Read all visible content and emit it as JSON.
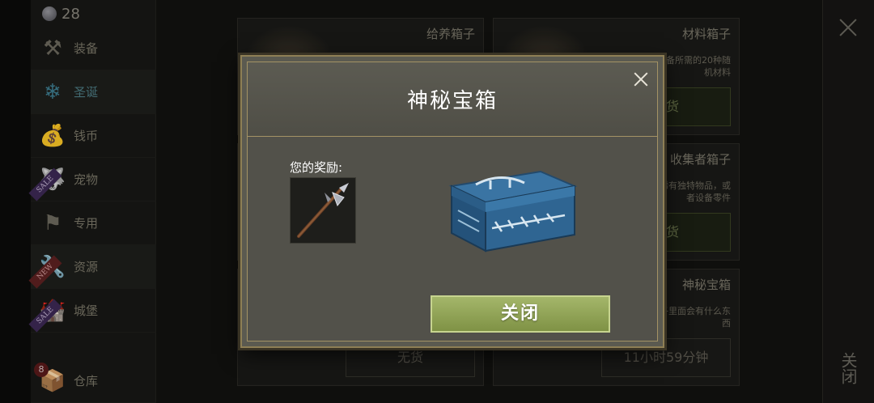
{
  "sidebar": {
    "currency_amount": "28",
    "items": [
      {
        "label": "装备",
        "icon": "crossed-tools-icon",
        "badge": ""
      },
      {
        "label": "圣诞",
        "icon": "snowflake-icon",
        "badge": ""
      },
      {
        "label": "钱币",
        "icon": "coin-bag-icon",
        "badge": ""
      },
      {
        "label": "宠物",
        "icon": "pet-icon",
        "badge": "SALE"
      },
      {
        "label": "专用",
        "icon": "banner-icon",
        "badge": ""
      },
      {
        "label": "资源",
        "icon": "tools-icon",
        "badge": "NEW"
      },
      {
        "label": "城堡",
        "icon": "castle-icon",
        "badge": "SALE"
      },
      {
        "label": "仓库",
        "icon": "storage-icon",
        "count": "8"
      }
    ]
  },
  "right_panel": {
    "close_label": "关闭"
  },
  "shop_cards": [
    {
      "title": "给养箱子",
      "desc": "",
      "button": "无货"
    },
    {
      "title": "材料箱子",
      "desc": "制作装备所需的20种随机材料",
      "button": "无货"
    },
    {
      "title": "收集者箱子",
      "desc": "包括稀有独特物品，或者设备零件",
      "button": "无货"
    },
    {
      "title": "",
      "desc": "",
      "button": "无货"
    },
    {
      "title": "",
      "desc": "",
      "button": "无货"
    },
    {
      "title": "神秘宝箱",
      "desc": "个箱子里面会有什么东西",
      "button": "11小时59分钟"
    }
  ],
  "modal": {
    "title": "神秘宝箱",
    "reward_label": "您的奖励:",
    "reward_item_icon": "halberd-icon",
    "chest_icon": "mystery-chest-icon",
    "close_button": "关闭"
  },
  "colors": {
    "accent_green": "#8fa353",
    "modal_border": "#8e7f55",
    "chest_blue": "#2f5d85"
  }
}
